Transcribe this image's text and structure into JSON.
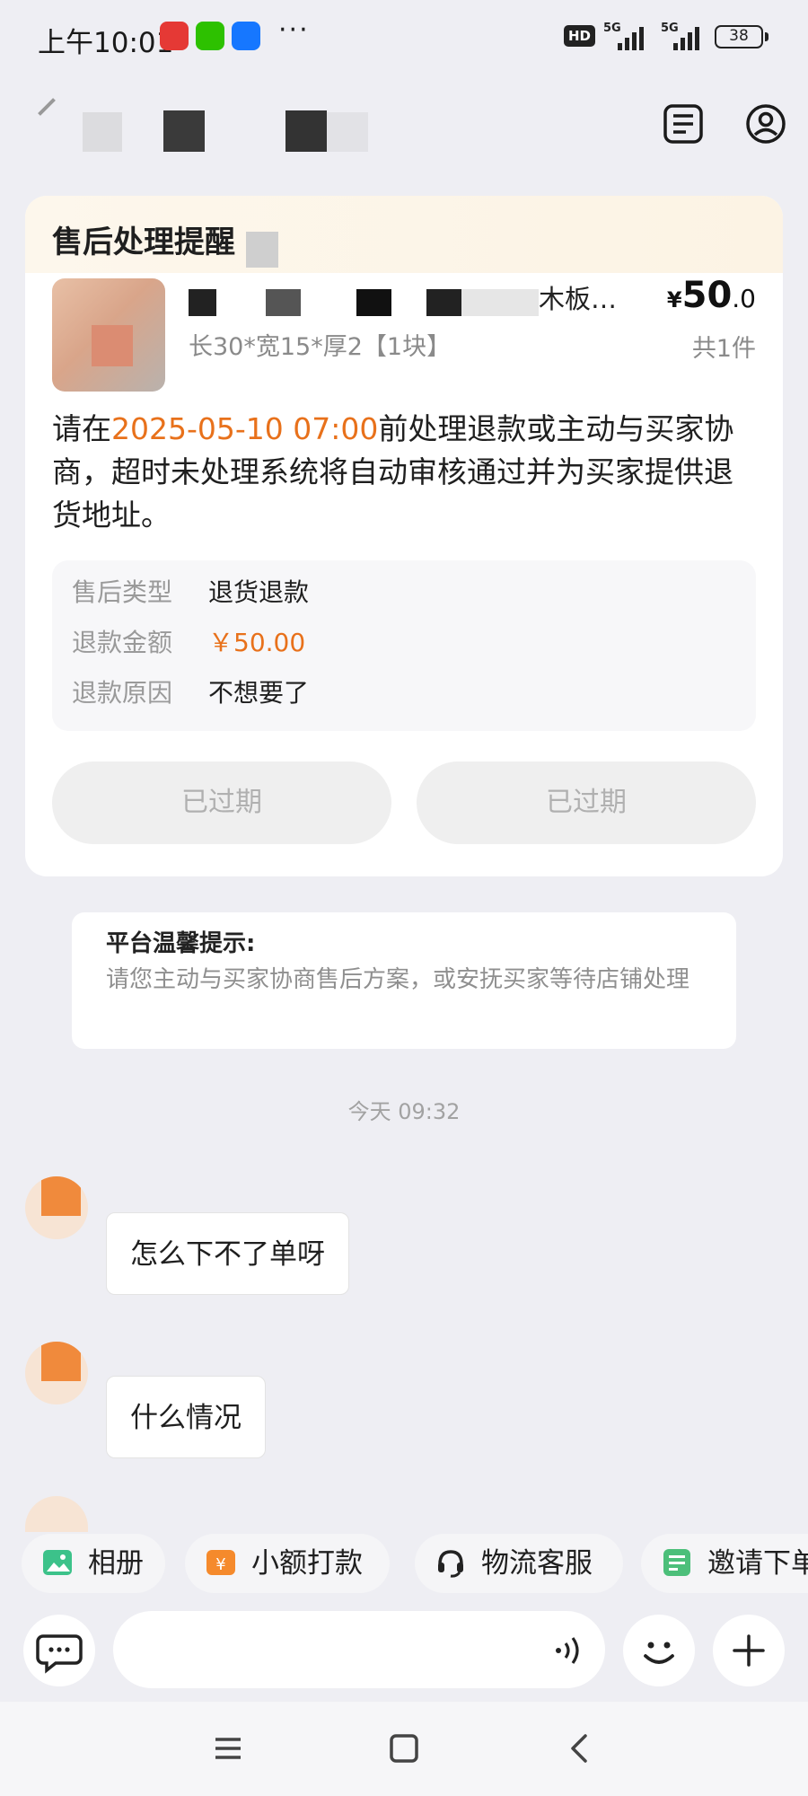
{
  "status_bar": {
    "time": "上午10:01",
    "overflow": "···",
    "hd_label": "HD",
    "net1": "5G",
    "net2": "5G",
    "battery": "38"
  },
  "header": {
    "icons": [
      "list-icon",
      "profile-icon"
    ]
  },
  "card": {
    "title": "售后处理提醒",
    "product_name": "木板…",
    "product_spec": "长30*宽15*厚2【1块】",
    "price_symbol": "¥",
    "price_int": "50",
    "price_dec": ".0",
    "quantity": "共1件",
    "notice_before": "请在",
    "notice_deadline": "2025-05-10 07:00",
    "notice_after": "前处理退款或主动与买家协商，超时未处理系统将自动审核通过并为买家提供退货地址。",
    "details": [
      {
        "label": "售后类型",
        "value": "退货退款"
      },
      {
        "label": "退款金额",
        "value": "￥50.00"
      },
      {
        "label": "退款原因",
        "value": "不想要了"
      }
    ],
    "buttons": [
      "已过期",
      "已过期"
    ]
  },
  "tip": {
    "title": "平台温馨提示:",
    "body": "请您主动与买家协商售后方案，或安抚买家等待店铺处理"
  },
  "timestamp": "今天  09:32",
  "messages": [
    {
      "text": "怎么下不了单呀"
    },
    {
      "text": "什么情况"
    }
  ],
  "quick_actions": [
    {
      "label": "相册",
      "icon": "photo-icon"
    },
    {
      "label": "小额打款",
      "icon": "transfer-icon"
    },
    {
      "label": "物流客服",
      "icon": "headset-icon"
    },
    {
      "label": "邀请下单",
      "icon": "invite-icon"
    }
  ],
  "input": {
    "placeholder": ""
  },
  "colors": {
    "accent": "#e8711b",
    "background": "#eeeef3"
  }
}
